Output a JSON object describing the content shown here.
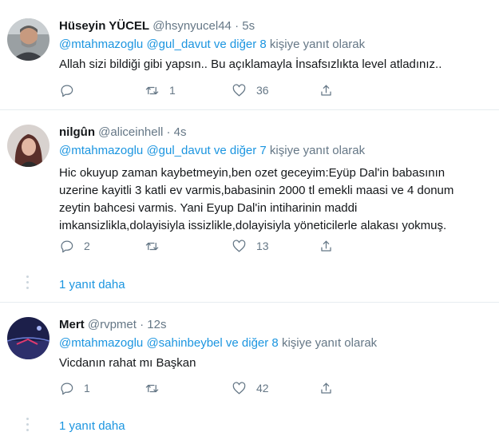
{
  "tweets": [
    {
      "name": "Hüseyin YÜCEL",
      "handle": "@hsynyucel44",
      "dot": "·",
      "time": "5s",
      "reply_to_users": "@mtahmazoglu @gul_davut ve diğer 8",
      "reply_suffix": " kişiye yanıt olarak",
      "lines": [
        "Allah sizi bildiği gibi yapsın.. Bu açıklamayla İnsafsızlıkta level atladınız.."
      ],
      "replies": "",
      "retweets": "1",
      "likes": "36",
      "more_replies": ""
    },
    {
      "name": "nilgûn",
      "handle": "@aliceinhell",
      "dot": "·",
      "time": "4s",
      "reply_to_users": "@mtahmazoglu @gul_davut ve diğer 7",
      "reply_suffix": " kişiye yanıt olarak",
      "lines": [
        "Hic okuyup zaman kaybetmeyin,ben ozet geceyim:Eyüp Dal'in babasının",
        "uzerine kayitli 3 katli ev varmis,babasinin 2000 tl emekli maasi ve 4 donum",
        "zeytin bahcesi varmis. Yani Eyup Dal'in intiharinin maddi",
        "imkansizlikla,dolayisiyla issizlikle,dolayisiyla yöneticilerle alakası yokmuş."
      ],
      "replies": "2",
      "retweets": "",
      "likes": "13",
      "more_replies": "1 yanıt daha"
    },
    {
      "name": "Mert",
      "handle": "@rvpmet",
      "dot": "·",
      "time": "12s",
      "reply_to_users": "@mtahmazoglu @sahinbeybel ve diğer 8",
      "reply_suffix": " kişiye yanıt olarak",
      "lines": [
        "Vicdanın rahat mı Başkan"
      ],
      "replies": "1",
      "retweets": "",
      "likes": "42",
      "more_replies": "1 yanıt daha"
    }
  ],
  "icons": {
    "reply": "reply-icon",
    "retweet": "retweet-icon",
    "like": "heart-icon",
    "share": "share-icon"
  },
  "colors": {
    "link": "#1b95e0",
    "muted": "#657786",
    "text": "#14171a",
    "divider": "#e6ecf0"
  }
}
